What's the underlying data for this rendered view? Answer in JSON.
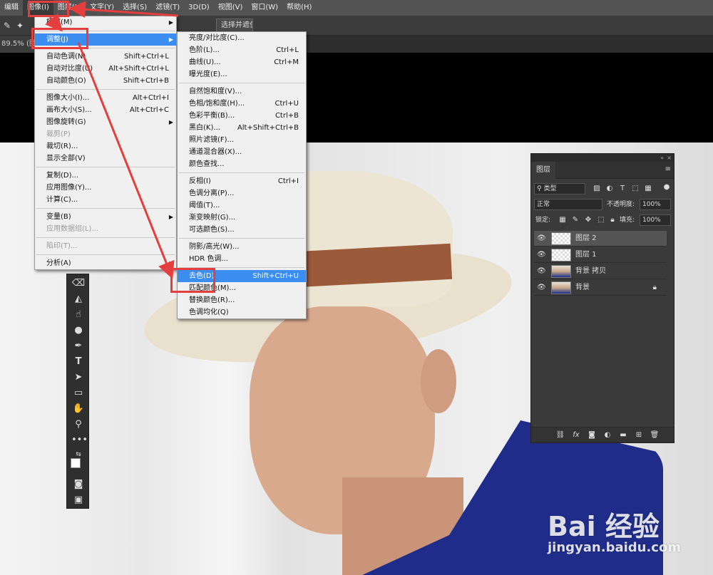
{
  "menubar": {
    "items": [
      "编辑",
      "图像(I)",
      "图层(L)",
      "文字(Y)",
      "选择(S)",
      "滤镜(T)",
      "3D(D)",
      "视图(V)",
      "窗口(W)",
      "帮助(H)"
    ],
    "active_index": 1
  },
  "options_bar": {
    "select_mask_label": "选择并遮住..."
  },
  "doc_tab": {
    "label": "89.5% (图"
  },
  "image_menu": {
    "items": [
      {
        "label": "模式(M)",
        "shortcut": "",
        "submenu": true
      },
      {
        "sep": true
      },
      {
        "label": "调整(J)",
        "shortcut": "",
        "submenu": true,
        "highlight": true
      },
      {
        "sep": true
      },
      {
        "label": "自动色调(N)",
        "shortcut": "Shift+Ctrl+L"
      },
      {
        "label": "自动对比度(U)",
        "shortcut": "Alt+Shift+Ctrl+L"
      },
      {
        "label": "自动颜色(O)",
        "shortcut": "Shift+Ctrl+B"
      },
      {
        "sep": true
      },
      {
        "label": "图像大小(I)...",
        "shortcut": "Alt+Ctrl+I"
      },
      {
        "label": "画布大小(S)...",
        "shortcut": "Alt+Ctrl+C"
      },
      {
        "label": "图像旋转(G)",
        "shortcut": "",
        "submenu": true
      },
      {
        "label": "裁剪(P)",
        "shortcut": "",
        "disabled": true
      },
      {
        "label": "裁切(R)...",
        "shortcut": ""
      },
      {
        "label": "显示全部(V)",
        "shortcut": ""
      },
      {
        "sep": true
      },
      {
        "label": "复制(D)...",
        "shortcut": ""
      },
      {
        "label": "应用图像(Y)...",
        "shortcut": ""
      },
      {
        "label": "计算(C)...",
        "shortcut": ""
      },
      {
        "sep": true
      },
      {
        "label": "变量(B)",
        "shortcut": "",
        "submenu": true
      },
      {
        "label": "应用数据组(L)...",
        "shortcut": "",
        "disabled": true
      },
      {
        "sep": true
      },
      {
        "label": "陷印(T)...",
        "shortcut": "",
        "disabled": true
      },
      {
        "sep": true
      },
      {
        "label": "分析(A)",
        "shortcut": "",
        "submenu": true
      }
    ]
  },
  "adjust_menu": {
    "items": [
      {
        "label": "亮度/对比度(C)...",
        "shortcut": ""
      },
      {
        "label": "色阶(L)...",
        "shortcut": "Ctrl+L"
      },
      {
        "label": "曲线(U)...",
        "shortcut": "Ctrl+M"
      },
      {
        "label": "曝光度(E)...",
        "shortcut": ""
      },
      {
        "sep": true
      },
      {
        "label": "自然饱和度(V)...",
        "shortcut": ""
      },
      {
        "label": "色相/饱和度(H)...",
        "shortcut": "Ctrl+U"
      },
      {
        "label": "色彩平衡(B)...",
        "shortcut": "Ctrl+B"
      },
      {
        "label": "黑白(K)...",
        "shortcut": "Alt+Shift+Ctrl+B"
      },
      {
        "label": "照片滤镜(F)...",
        "shortcut": ""
      },
      {
        "label": "通道混合器(X)...",
        "shortcut": ""
      },
      {
        "label": "颜色查找...",
        "shortcut": ""
      },
      {
        "sep": true
      },
      {
        "label": "反相(I)",
        "shortcut": "Ctrl+I"
      },
      {
        "label": "色调分离(P)...",
        "shortcut": ""
      },
      {
        "label": "阈值(T)...",
        "shortcut": ""
      },
      {
        "label": "渐变映射(G)...",
        "shortcut": ""
      },
      {
        "label": "可选颜色(S)...",
        "shortcut": ""
      },
      {
        "sep": true
      },
      {
        "label": "阴影/高光(W)...",
        "shortcut": ""
      },
      {
        "label": "HDR 色调...",
        "shortcut": ""
      },
      {
        "sep": true
      },
      {
        "label": "去色(D)",
        "shortcut": "Shift+Ctrl+U",
        "highlight": true
      },
      {
        "label": "匹配颜色(M)...",
        "shortcut": ""
      },
      {
        "label": "替换颜色(R)...",
        "shortcut": ""
      },
      {
        "label": "色调均化(Q)",
        "shortcut": ""
      }
    ]
  },
  "layers_panel": {
    "title": "图层",
    "filter_label": "类型",
    "blend_mode": "正常",
    "opacity_label": "不透明度:",
    "opacity_value": "100%",
    "lock_label": "锁定:",
    "fill_label": "填充:",
    "fill_value": "100%",
    "layers": [
      {
        "name": "图层 2",
        "thumb": "checker",
        "selected": true,
        "locked": false
      },
      {
        "name": "图层 1",
        "thumb": "checker",
        "selected": false,
        "locked": false
      },
      {
        "name": "背景 拷贝",
        "thumb": "photo",
        "selected": false,
        "locked": false
      },
      {
        "name": "背景",
        "thumb": "photo",
        "selected": false,
        "locked": true
      }
    ]
  },
  "watermark": {
    "logo": "Bai 经验",
    "url": "jingyan.baidu.com"
  },
  "colors": {
    "annotation_red": "#e53e3e",
    "menu_highlight": "#3b8ef0"
  }
}
